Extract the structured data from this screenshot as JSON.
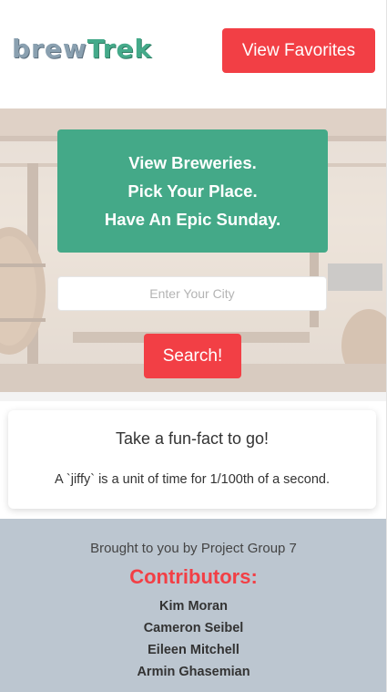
{
  "header": {
    "logo": {
      "part1": "brew",
      "part2": "Trek"
    },
    "favorites_label": "View Favorites"
  },
  "hero": {
    "lines": [
      "View Breweries.",
      "Pick Your Place.",
      "Have An Epic Sunday."
    ],
    "city_placeholder": "Enter Your City",
    "search_label": "Search!"
  },
  "fact": {
    "title": "Take a fun-fact to go!",
    "text": "A `jiffy` is a unit of time for 1/100th of a second."
  },
  "footer": {
    "credit": "Brought to you by Project Group 7",
    "contributors_title": "Contributors:",
    "contributors": [
      "Kim Moran",
      "Cameron Seibel",
      "Eileen Mitchell",
      "Armin Ghasemian"
    ]
  },
  "colors": {
    "accent": "#f23f45",
    "brand_green": "#44a988",
    "footer_bg": "#bcc6d0"
  }
}
